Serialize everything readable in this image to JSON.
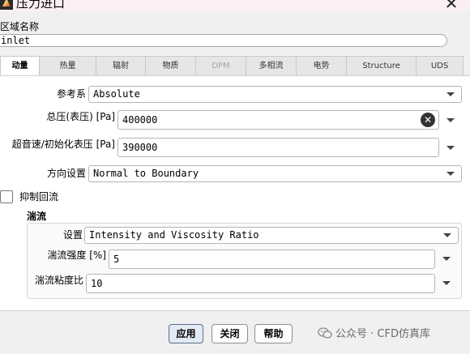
{
  "window": {
    "title": "压力进口",
    "close_glyph": "✕"
  },
  "zone": {
    "label": "区域名称",
    "value": "inlet"
  },
  "tabs": [
    {
      "label": "动量",
      "active": true
    },
    {
      "label": "热量"
    },
    {
      "label": "辐射"
    },
    {
      "label": "物质"
    },
    {
      "label": "DPM",
      "disabled": true
    },
    {
      "label": "多相流"
    },
    {
      "label": "电势"
    },
    {
      "label": "Structure"
    },
    {
      "label": "UDS"
    }
  ],
  "form": {
    "reference_frame": {
      "label": "参考系",
      "value": "Absolute"
    },
    "gauge_total_pressure": {
      "label": "总压(表压) [Pa]",
      "value": "400000",
      "clear_glyph": "✕"
    },
    "supersonic_initial_gauge_pressure": {
      "label": "超音速/初始化表压 [Pa]",
      "value": "390000"
    },
    "direction_spec": {
      "label": "方向设置",
      "value": "Normal to Boundary"
    },
    "prevent_reverse_flow": {
      "label": "抑制回流",
      "checked": false
    }
  },
  "turbulence": {
    "title": "湍流",
    "spec": {
      "label": "设置",
      "value": "Intensity and Viscosity Ratio"
    },
    "intensity": {
      "label": "湍流强度 [%]",
      "value": "5"
    },
    "viscosity_ratio": {
      "label": "湍流粘度比",
      "value": "10"
    }
  },
  "buttons": {
    "apply": "应用",
    "close": "关闭",
    "help": "帮助"
  },
  "watermark": {
    "text": "公众号 · CFD仿真库"
  },
  "colors": {
    "titlebar": "#fbeef5",
    "panel": "#ffffff",
    "tab_bg": "#e6e6e6",
    "primary_button": "#e3eaf4"
  },
  "icons": [
    "app-logo-icon",
    "close-icon",
    "clear-icon",
    "chevron-down-icon",
    "wechat-icon"
  ]
}
